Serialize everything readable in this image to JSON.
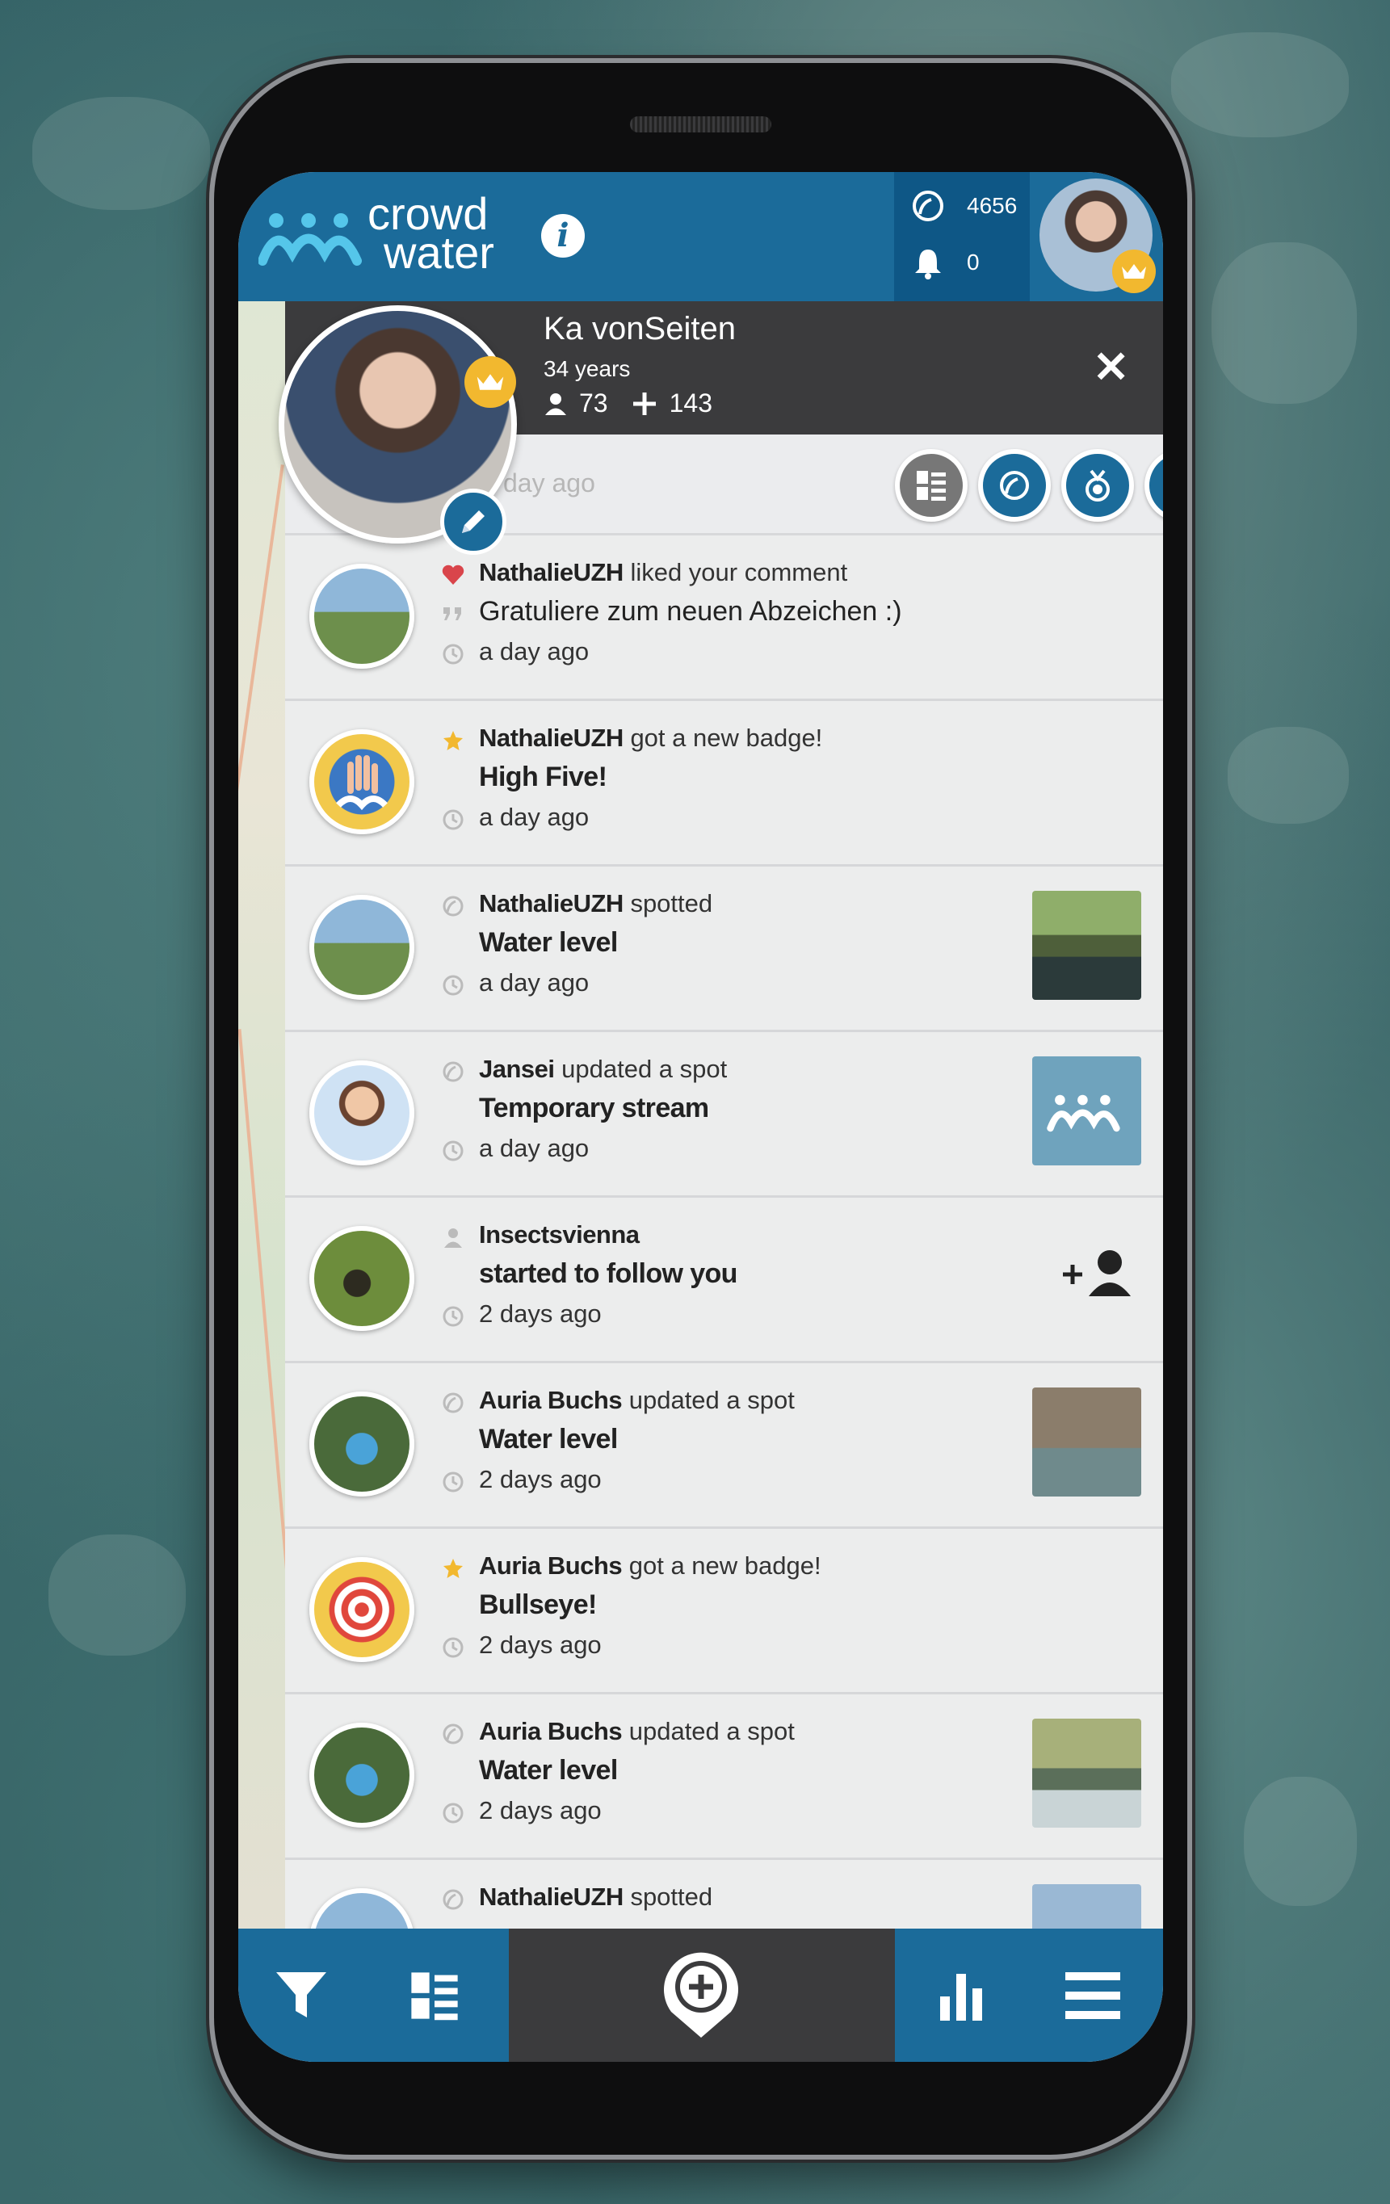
{
  "header": {
    "brand_line1": "crowd",
    "brand_line2": "water",
    "info_label": "i",
    "points": "4656",
    "notifications": "0"
  },
  "profile": {
    "name": "Ka vonSeiten",
    "age": "34 years",
    "followers": "73",
    "following": "143",
    "close_label": "✕",
    "faded_text": "day ago"
  },
  "feed": [
    {
      "user": "NathalieUZH",
      "action": "liked your comment",
      "detail": "Gratuliere zum neuen Abzeichen :)",
      "time": "a day ago",
      "type": "like"
    },
    {
      "user": "NathalieUZH",
      "action": "got a new badge!",
      "detail": "High Five!",
      "time": "a day ago",
      "type": "badge"
    },
    {
      "user": "NathalieUZH",
      "action": "spotted",
      "detail": "Water level",
      "time": "a day ago",
      "type": "spot"
    },
    {
      "user": "Jansei",
      "action": "updated a spot",
      "detail": "Temporary stream",
      "time": "a day ago",
      "type": "spot"
    },
    {
      "user": "Insectsvienna",
      "action": "",
      "detail": "started to follow you",
      "time": "2 days ago",
      "type": "follow"
    },
    {
      "user": "Auria Buchs",
      "action": "updated a spot",
      "detail": "Water level",
      "time": "2 days ago",
      "type": "spot"
    },
    {
      "user": "Auria Buchs",
      "action": "got a new badge!",
      "detail": "Bullseye!",
      "time": "2 days ago",
      "type": "badge"
    },
    {
      "user": "Auria Buchs",
      "action": "updated a spot",
      "detail": "Water level",
      "time": "2 days ago",
      "type": "spot"
    },
    {
      "user": "NathalieUZH",
      "action": "spotted",
      "detail": "",
      "time": "",
      "type": "spot"
    }
  ],
  "colors": {
    "primary": "#1b6b9a",
    "dark": "#3b3b3d",
    "accent": "#f2b82f",
    "like": "#d9454b"
  }
}
